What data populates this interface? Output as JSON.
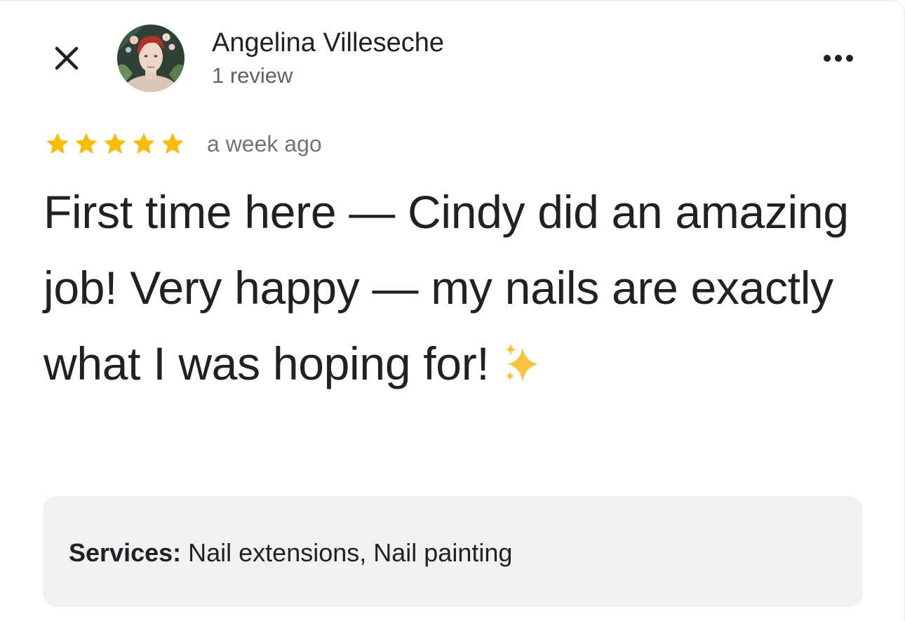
{
  "header": {
    "close_icon": "close-icon",
    "more_icon": "more-horizontal-icon",
    "reviewer": {
      "name": "Angelina Villeseche",
      "review_count": "1 review"
    }
  },
  "review": {
    "rating": 5,
    "rating_max": 5,
    "star_color": "#fbbc04",
    "date": "a week ago",
    "text": "First time here — Cindy did an amazing job! Very happy — my nails are exactly what I was hoping for!",
    "emoji": "✨"
  },
  "services": {
    "label": "Services:",
    "value": "Nail extensions, Nail painting"
  }
}
